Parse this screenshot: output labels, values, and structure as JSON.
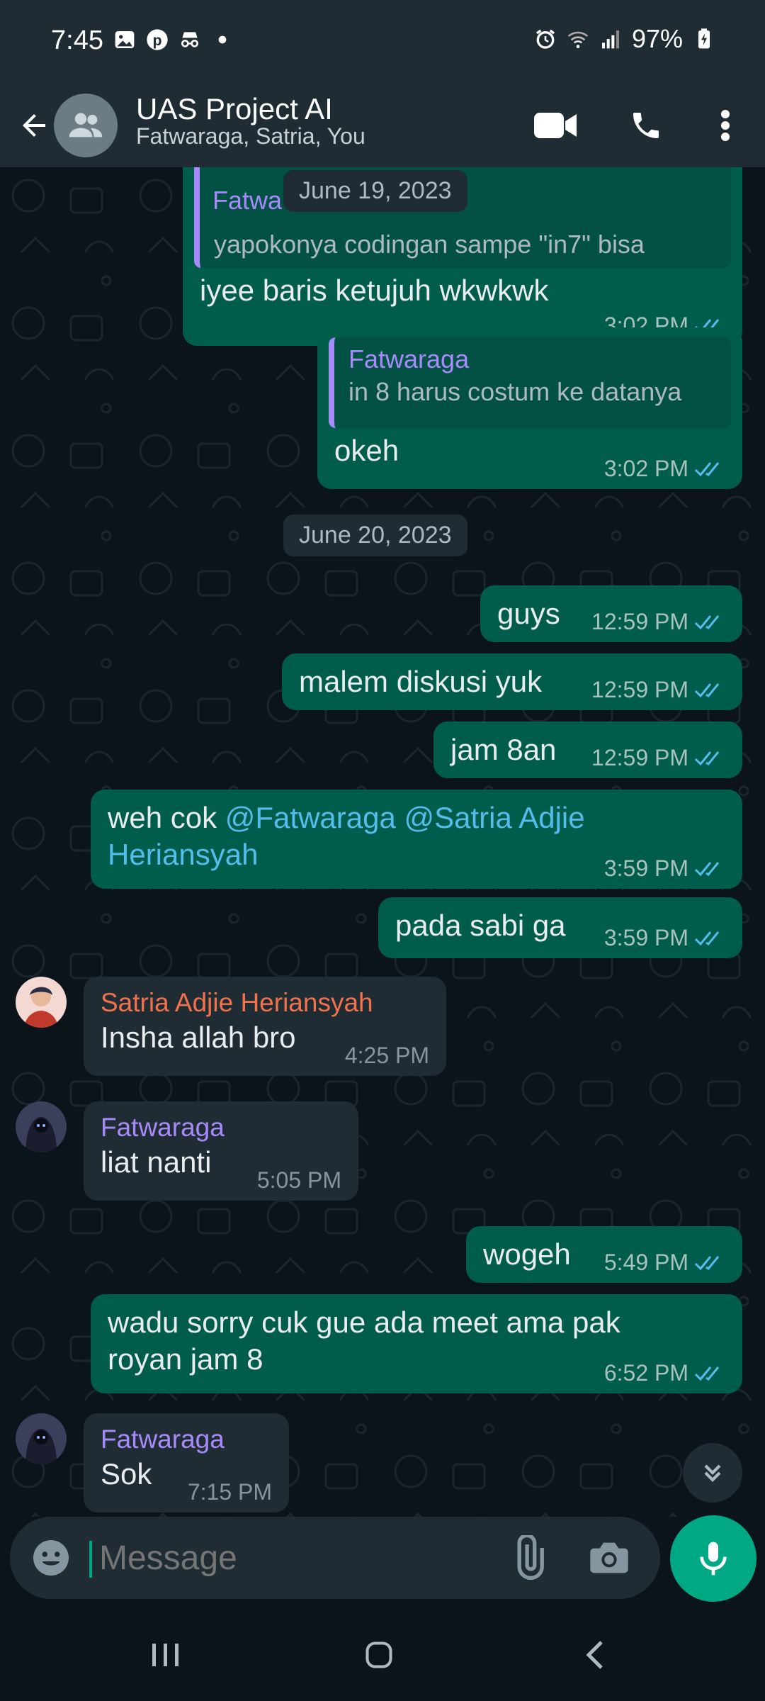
{
  "status_bar": {
    "time": "7:45",
    "battery": "97%",
    "left_icons": [
      "gallery-icon",
      "pinterest-icon",
      "incognito-icon",
      "dot-icon"
    ],
    "right_icons": [
      "alarm-icon",
      "wifi-icon",
      "signal-icon",
      "battery-charging-icon"
    ]
  },
  "header": {
    "title": "UAS Project AI",
    "subtitle": "Fatwaraga, Satria, You",
    "icons": [
      "back-arrow-icon",
      "group-avatar-icon",
      "video-call-icon",
      "phone-call-icon",
      "more-vert-icon"
    ]
  },
  "colors": {
    "outgoing_bubble": "#005c4b",
    "incoming_bubble": "#202c33",
    "accent": "#00a884",
    "mention": "#53bdeb",
    "read_ticks": "#53bdeb",
    "sender_satria": "#f0714a",
    "sender_fatwaraga": "#a78bfa"
  },
  "chat": {
    "messages": [
      {
        "dir": "out",
        "quote": {
          "name": "Fatwa",
          "text": "yapokonya codingan sampe \"in7\" bisa"
        },
        "text": "iyee baris ketujuh wkwkwk",
        "time": "3:02 PM"
      },
      {
        "dir": "out",
        "quote": {
          "name": "Fatwaraga",
          "text": "in 8 harus costum ke datanya"
        },
        "text": "okeh",
        "time": "3:02 PM"
      },
      {
        "dir": "out",
        "text": "guys",
        "time": "12:59 PM"
      },
      {
        "dir": "out",
        "text": "malem diskusi yuk",
        "time": "12:59 PM"
      },
      {
        "dir": "out",
        "text": "jam 8an",
        "time": "12:59 PM"
      },
      {
        "dir": "out",
        "text_pre": "weh cok ",
        "mentions": [
          "@Fatwaraga",
          "@Satria Adjie",
          "Heriansyah"
        ],
        "time": "3:59 PM"
      },
      {
        "dir": "out",
        "text": "pada sabi ga",
        "time": "3:59 PM"
      },
      {
        "dir": "in",
        "sender": "Satria Adjie Heriansyah",
        "text": "Insha allah bro",
        "time": "4:25 PM"
      },
      {
        "dir": "in",
        "sender": "Fatwaraga",
        "text": "liat nanti",
        "time": "5:05 PM"
      },
      {
        "dir": "out",
        "text": "wogeh",
        "time": "5:49 PM"
      },
      {
        "dir": "out",
        "text_line1": "wadu sorry cuk gue ada meet ama pak",
        "text_line2": "royan jam 8",
        "time": "6:52 PM"
      },
      {
        "dir": "in",
        "sender": "Fatwaraga",
        "text": "Sok",
        "time": "7:15 PM"
      }
    ],
    "date_chips": [
      "June 19, 2023",
      "June 20, 2023"
    ]
  },
  "composer": {
    "placeholder": "Message",
    "icons": [
      "emoji-icon",
      "attach-icon",
      "camera-icon",
      "mic-icon",
      "scroll-down-icon"
    ]
  },
  "navbar": {
    "icons": [
      "recent-apps-icon",
      "home-icon",
      "back-nav-icon"
    ]
  }
}
